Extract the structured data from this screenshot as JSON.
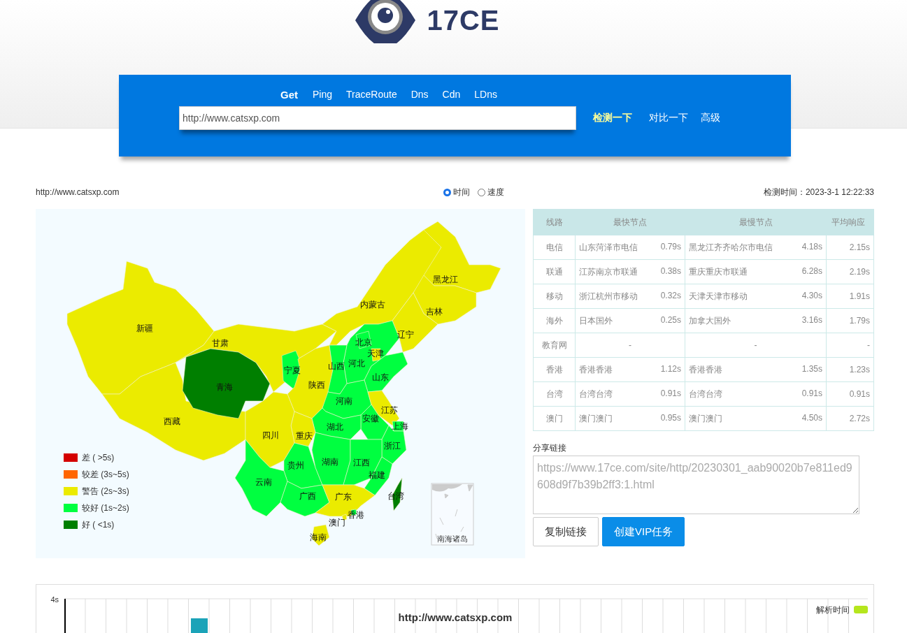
{
  "header": {
    "logo_text": "17CE"
  },
  "tabs": [
    {
      "label": "Get",
      "selected": true
    },
    {
      "label": "Ping",
      "selected": false
    },
    {
      "label": "TraceRoute",
      "selected": false
    },
    {
      "label": "Dns",
      "selected": false
    },
    {
      "label": "Cdn",
      "selected": false
    },
    {
      "label": "LDns",
      "selected": false
    }
  ],
  "search": {
    "value": "http://www.catsxp.com"
  },
  "actions": [
    {
      "label": "检测一下",
      "kind": "primary"
    },
    {
      "label": "对比一下",
      "kind": "link"
    },
    {
      "label": "高级",
      "kind": "link"
    }
  ],
  "info": {
    "url": "http://www.catsxp.com",
    "modes": [
      {
        "label": "时间",
        "selected": true
      },
      {
        "label": "速度",
        "selected": false
      }
    ],
    "check_time": "检测时间：2023-3-1 12:22:33"
  },
  "map": {
    "provinces": [
      {
        "name": "新疆",
        "color": "#ebeb00"
      },
      {
        "name": "西藏",
        "color": "#ebeb00"
      },
      {
        "name": "甘肃",
        "color": "#ebeb00"
      },
      {
        "name": "青海",
        "color": "#007f00"
      },
      {
        "name": "宁夏",
        "color": "#00ff40"
      },
      {
        "name": "陕西",
        "color": "#ebeb00"
      },
      {
        "name": "内蒙古",
        "color": "#ebeb00"
      },
      {
        "name": "黑龙江",
        "color": "#ebeb00"
      },
      {
        "name": "吉林",
        "color": "#ebeb00"
      },
      {
        "name": "辽宁",
        "color": "#ebeb00"
      },
      {
        "name": "河北",
        "color": "#00ff40"
      },
      {
        "name": "北京",
        "color": "#00ff40"
      },
      {
        "name": "天津",
        "color": "#ebeb00"
      },
      {
        "name": "山西",
        "color": "#00ff40"
      },
      {
        "name": "山东",
        "color": "#00ff40"
      },
      {
        "name": "河南",
        "color": "#00ff40"
      },
      {
        "name": "江苏",
        "color": "#ebeb00"
      },
      {
        "name": "安徽",
        "color": "#00ff40"
      },
      {
        "name": "上海",
        "color": "#00ff40"
      },
      {
        "name": "湖北",
        "color": "#00ff40"
      },
      {
        "name": "重庆",
        "color": "#ebeb00"
      },
      {
        "name": "四川",
        "color": "#ebeb00"
      },
      {
        "name": "浙江",
        "color": "#00ff40"
      },
      {
        "name": "贵州",
        "color": "#00ff40"
      },
      {
        "name": "湖南",
        "color": "#00ff40"
      },
      {
        "name": "江西",
        "color": "#00ff40"
      },
      {
        "name": "云南",
        "color": "#00ff40"
      },
      {
        "name": "福建",
        "color": "#00ff40"
      },
      {
        "name": "广西",
        "color": "#00ff40"
      },
      {
        "name": "广东",
        "color": "#ebeb00"
      },
      {
        "name": "台湾",
        "color": "#007f00"
      },
      {
        "name": "香港",
        "color": "#00ff40"
      },
      {
        "name": "澳门",
        "color": "#ebeb00"
      },
      {
        "name": "海南",
        "color": "#ebeb00"
      }
    ],
    "legend": [
      {
        "label": "差 ( >5s)",
        "color": "#d40000"
      },
      {
        "label": "较差 (3s~5s)",
        "color": "#ff6600"
      },
      {
        "label": "警告 (2s~3s)",
        "color": "#ebeb00"
      },
      {
        "label": "较好 (1s~2s)",
        "color": "#00ff40"
      },
      {
        "label": "好 ( <1s)",
        "color": "#007f00"
      }
    ],
    "inset_label": "南海诸岛"
  },
  "table": {
    "columns": [
      "线路",
      "最快节点",
      "最慢节点",
      "平均响应"
    ],
    "rows": [
      {
        "line": "电信",
        "fastest_node": "山东菏泽市电信",
        "fastest_time": "0.79s",
        "slowest_node": "黑龙江齐齐哈尔市电信",
        "slowest_time": "4.18s",
        "average": "2.15s"
      },
      {
        "line": "联通",
        "fastest_node": "江苏南京市联通",
        "fastest_time": "0.38s",
        "slowest_node": "重庆重庆市联通",
        "slowest_time": "6.28s",
        "average": "2.19s"
      },
      {
        "line": "移动",
        "fastest_node": "浙江杭州市移动",
        "fastest_time": "0.32s",
        "slowest_node": "天津天津市移动",
        "slowest_time": "4.30s",
        "average": "1.91s"
      },
      {
        "line": "海外",
        "fastest_node": "日本国外",
        "fastest_time": "0.25s",
        "slowest_node": "加拿大国外",
        "slowest_time": "3.16s",
        "average": "1.79s"
      },
      {
        "line": "教育网",
        "fastest_node": "-",
        "slowest_node": "-",
        "average": "-"
      },
      {
        "line": "香港",
        "fastest_node": "香港香港",
        "fastest_time": "1.12s",
        "slowest_node": "香港香港",
        "slowest_time": "1.35s",
        "average": "1.23s"
      },
      {
        "line": "台湾",
        "fastest_node": "台湾台湾",
        "fastest_time": "0.91s",
        "slowest_node": "台湾台湾",
        "slowest_time": "0.91s",
        "average": "0.91s"
      },
      {
        "line": "澳门",
        "fastest_node": "澳门澳门",
        "fastest_time": "0.95s",
        "slowest_node": "澳门澳门",
        "slowest_time": "4.50s",
        "average": "2.72s"
      }
    ]
  },
  "share": {
    "label": "分享链接",
    "value": "https://www.17ce.com/site/http/20230301_aab90020b7e811ed9608d9f7b39b2ff3:1.html",
    "buttons": [
      {
        "label": "复制链接",
        "kind": "default"
      },
      {
        "label": "创建VIP任务",
        "kind": "primary"
      }
    ]
  },
  "chart": {
    "title": "http://www.catsxp.com",
    "ytick": "4s",
    "legend": [
      {
        "label": "解析时间",
        "color": "#b5e61d"
      }
    ]
  }
}
